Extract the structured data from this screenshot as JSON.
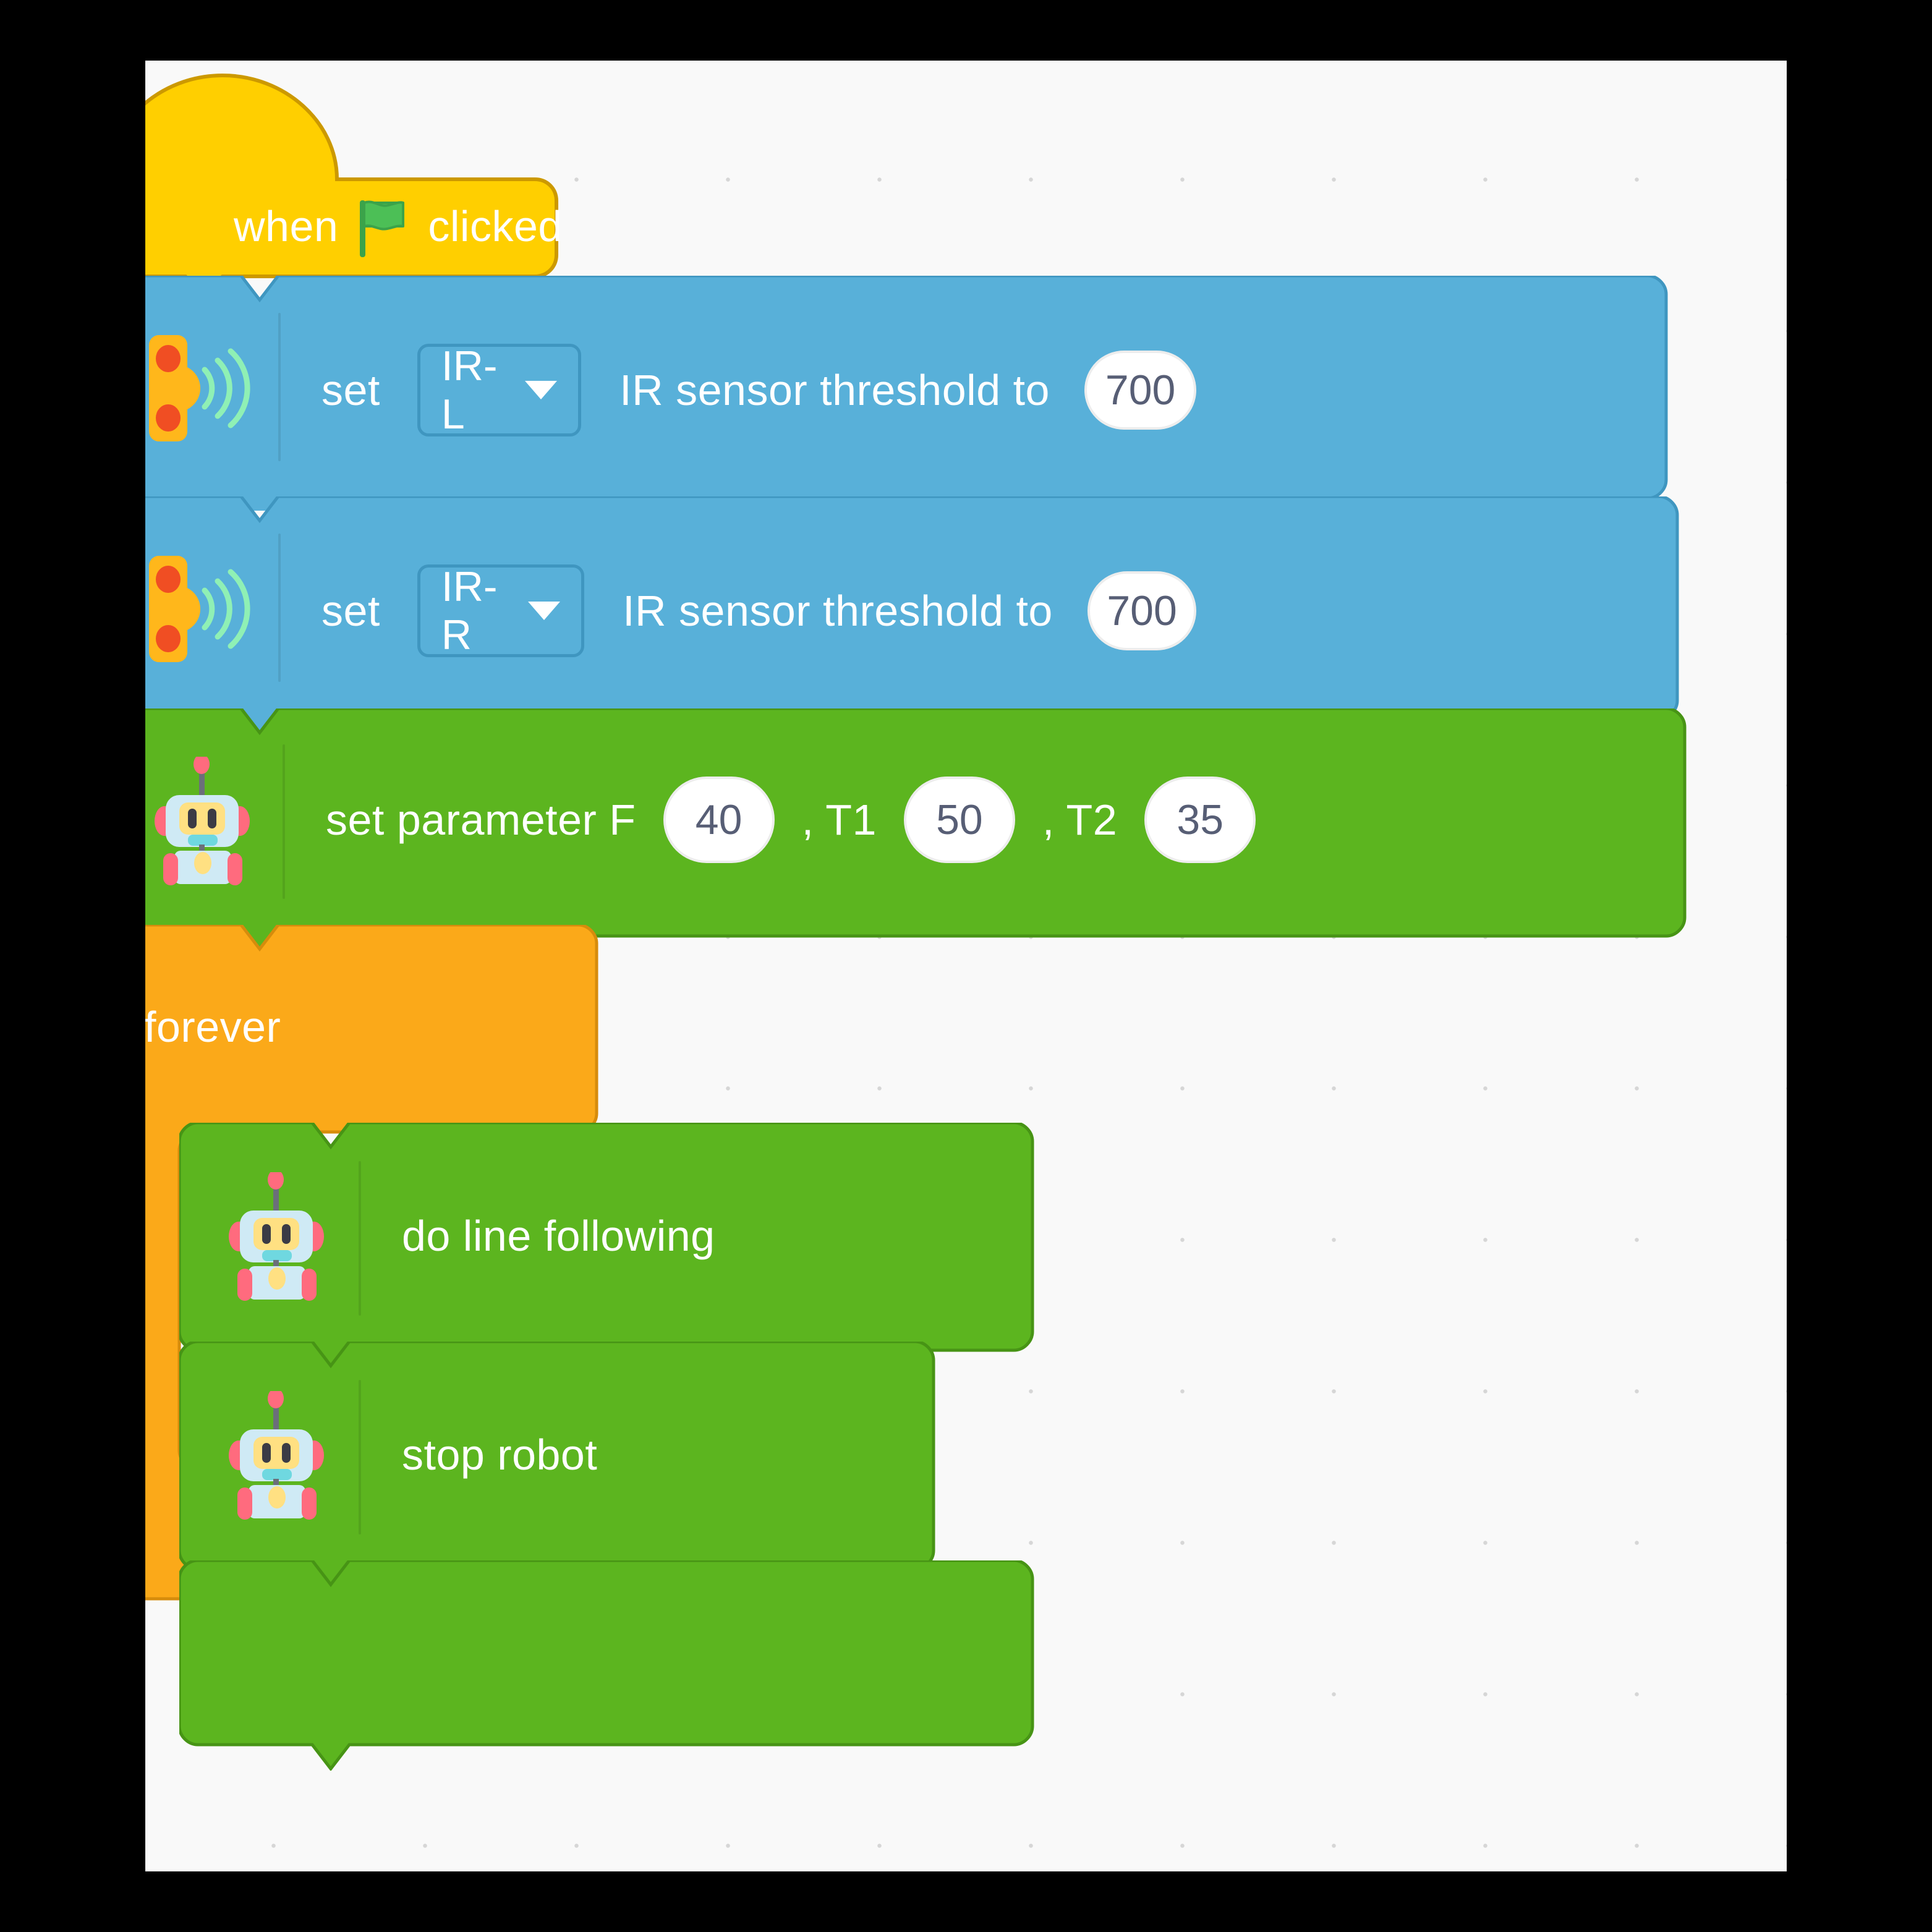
{
  "canvas": {
    "background": "#f9f9f9",
    "grid_dot_color": "#d6d6d6"
  },
  "palette": {
    "hat_yellow": "#ffcf00",
    "hat_yellow_border": "#cc9900",
    "sensor_blue": "#58b0d9",
    "sensor_blue_border": "#3f96c0",
    "robot_green": "#5cb51f",
    "robot_green_border": "#479415",
    "control_orange": "#fba919",
    "control_orange_border": "#d68c0c",
    "input_white": "#ffffff",
    "input_text": "#575e75",
    "flag_green": "#4cbf56"
  },
  "script": {
    "hat": {
      "prefix": "when",
      "icon": "green-flag-icon",
      "suffix": "clicked"
    },
    "blocks": [
      {
        "id": "set-ir-l-threshold",
        "category": "sensor",
        "icon": "ir-sensor-icon",
        "prefix": "set",
        "dropdown_value": "IR-L",
        "middle": "IR sensor threshold to",
        "value": "700"
      },
      {
        "id": "set-ir-r-threshold",
        "category": "sensor",
        "icon": "ir-sensor-icon",
        "prefix": "set",
        "dropdown_value": "IR-R",
        "middle": "IR sensor threshold to",
        "value": "700"
      },
      {
        "id": "set-parameter",
        "category": "robot",
        "icon": "robot-icon",
        "label_f": "set parameter F",
        "value_f": "40",
        "label_t1": ", T1",
        "value_t1": "50",
        "label_t2": ", T2",
        "value_t2": "35"
      },
      {
        "id": "forever",
        "category": "control",
        "label": "forever",
        "loop_icon": "loop-arrow-icon",
        "children": [
          {
            "id": "do-line-following",
            "category": "robot",
            "icon": "robot-icon",
            "label": "do line following"
          },
          {
            "id": "stop-robot",
            "category": "robot",
            "icon": "robot-icon",
            "label": "stop robot"
          },
          {
            "id": "empty-robot-block",
            "category": "robot",
            "icon": "",
            "label": ""
          }
        ]
      }
    ]
  }
}
